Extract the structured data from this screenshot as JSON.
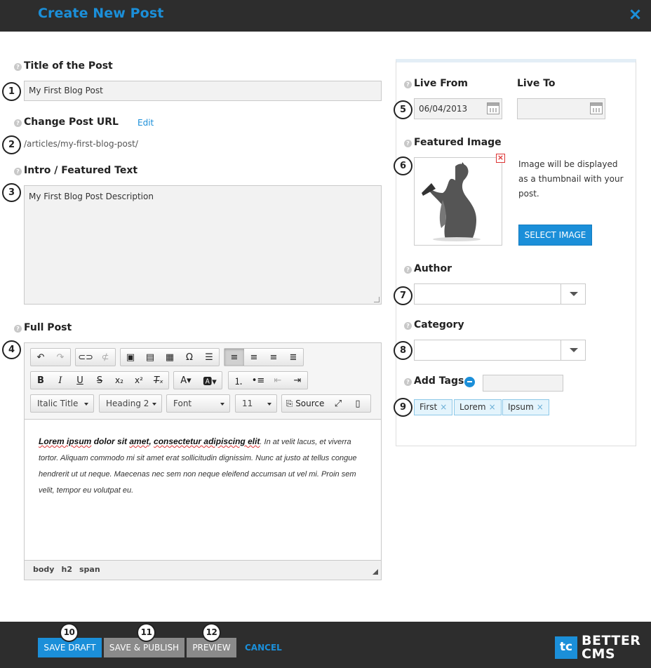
{
  "header": {
    "title": "Create New Post"
  },
  "title_field": {
    "label": "Title of the Post",
    "value": "My First Blog Post"
  },
  "url_field": {
    "label": "Change Post URL",
    "edit_label": "Edit",
    "value": "/articles/my-first-blog-post/"
  },
  "intro_field": {
    "label": "Intro / Featured Text",
    "value": "My First Blog Post Description"
  },
  "full_post": {
    "label": "Full Post",
    "toolbar": {
      "style_combo": "Italic Title",
      "format_combo": "Heading 2",
      "font_combo": "Font",
      "size_combo": "11",
      "source_label": "Source"
    },
    "content": {
      "bold_a": "Lorem ipsum",
      "bold_b": " dolor sit ",
      "bold_c": "amet",
      "bold_d": ", ",
      "bold_e": "consectetur adipiscing elit",
      "line1": ". In at velit lacus, et viverra",
      "line2": "tortor. Aliquam commodo mi sit amet erat sollicitudin dignissim. Nunc at justo at tellus congue",
      "line3": "hendrerit ut ut neque. Maecenas nec sem non neque eleifend accumsan ut vel mi. Proin sem",
      "line4": "velit, tempor eu volutpat eu."
    },
    "path": [
      "body",
      "h2",
      "span"
    ]
  },
  "sidebar": {
    "live_from": {
      "label": "Live From",
      "value": "06/04/2013"
    },
    "live_to": {
      "label": "Live To",
      "value": ""
    },
    "featured_image": {
      "label": "Featured Image",
      "hint": "Image will be displayed as a thumbnail with your post.",
      "button": "SELECT IMAGE"
    },
    "author": {
      "label": "Author",
      "value": ""
    },
    "category": {
      "label": "Category",
      "value": ""
    },
    "tags": {
      "label": "Add Tags",
      "input": "",
      "items": [
        "First",
        "Lorem",
        "Ipsum"
      ]
    }
  },
  "callouts": [
    "1",
    "2",
    "3",
    "4",
    "5",
    "6",
    "7",
    "8",
    "9",
    "10",
    "11",
    "12"
  ],
  "footer": {
    "save_draft": "SAVE DRAFT",
    "save_publish": "SAVE & PUBLISH",
    "preview": "PREVIEW",
    "cancel": "CANCEL"
  },
  "brand": {
    "logo": "tc",
    "line1": "BETTER",
    "line2": "CMS"
  },
  "colors": {
    "accent": "#1b8fd9",
    "header_bg": "#2d2d2d",
    "tag_bg": "#e4f4fc"
  }
}
